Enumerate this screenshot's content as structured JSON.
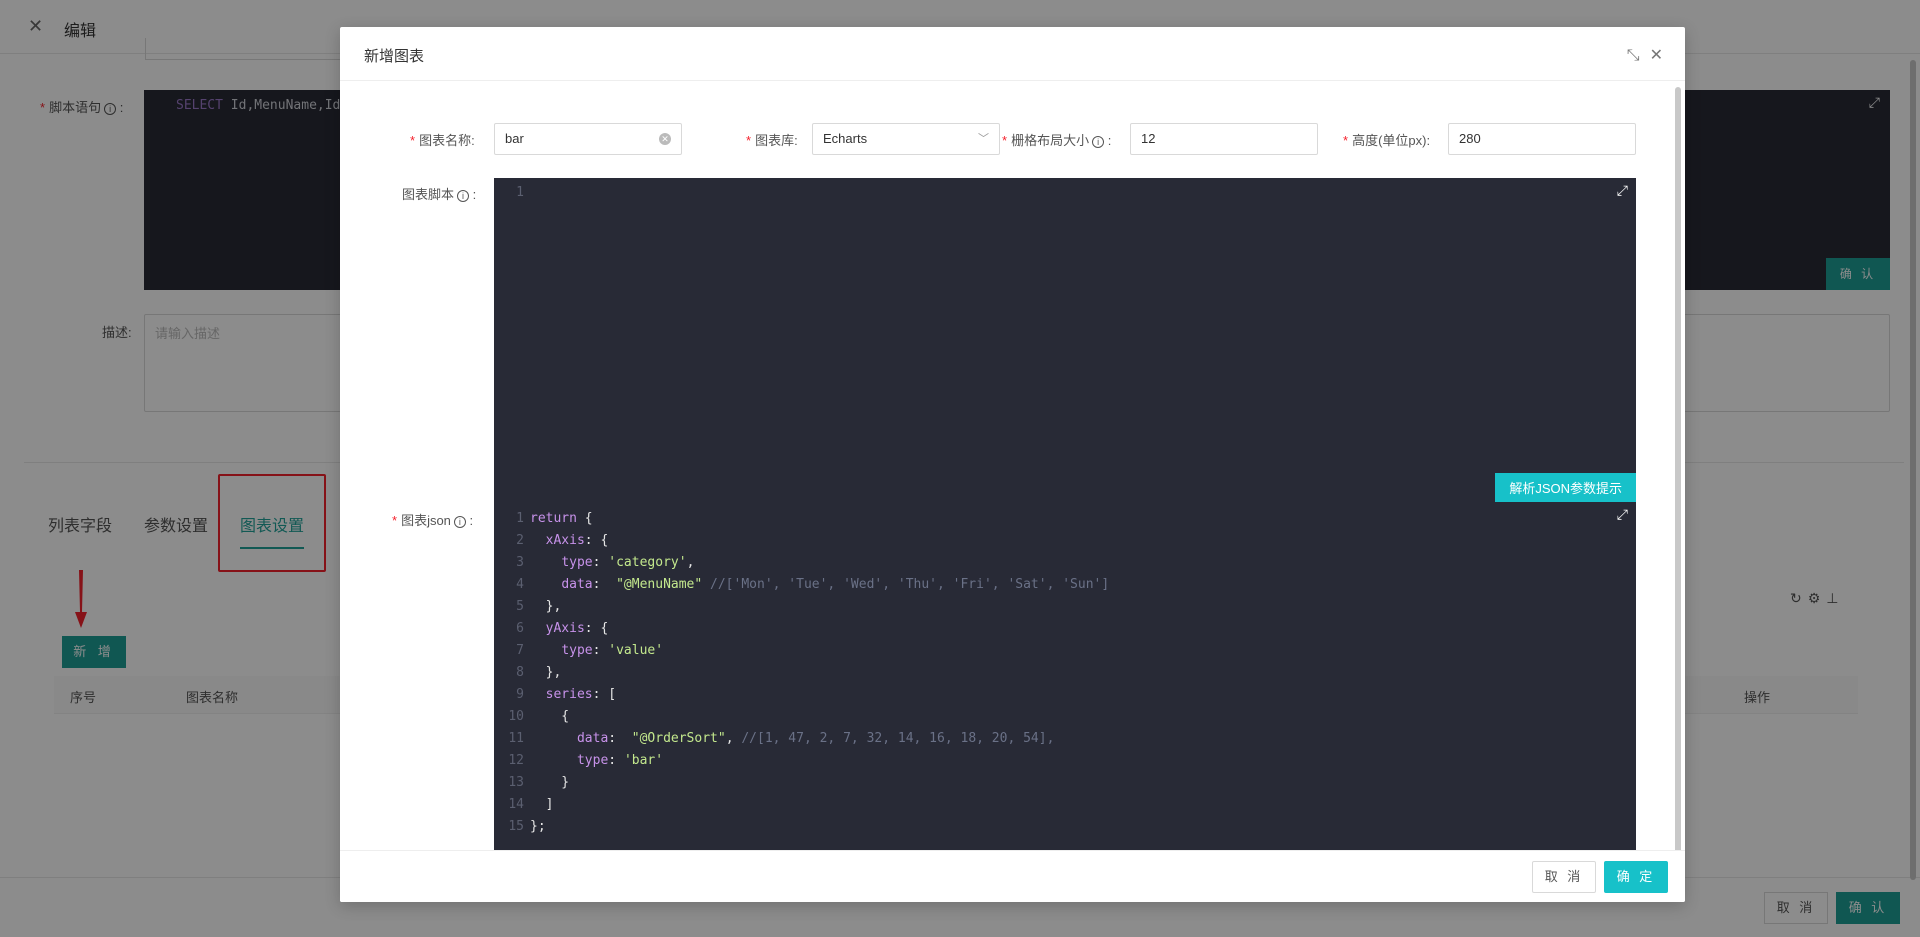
{
  "background": {
    "title": "编辑",
    "script_label": "脚本语句",
    "sql_preview_kw": "SELECT",
    "sql_preview_rest": "Id,MenuName,Id",
    "sql_confirm": "确 认",
    "desc_label": "描述:",
    "desc_placeholder": "请输入描述",
    "tabs": [
      "列表字段",
      "参数设置",
      "图表设置"
    ],
    "active_tab": "图表设置",
    "add_button": "新 增",
    "table_headers": [
      "序号",
      "图表名称",
      "操作"
    ],
    "tool_icons": [
      "refresh-icon",
      "settings-icon",
      "column-height-icon"
    ],
    "footer_cancel": "取 消",
    "footer_confirm": "确 认",
    "highlight_color": "#f5222d"
  },
  "modal": {
    "title": "新增图表",
    "fields": {
      "chart_name_label": "图表名称:",
      "chart_name_value": "bar",
      "chart_lib_label": "图表库:",
      "chart_lib_value": "Echarts",
      "grid_size_label": "栅格布局大小",
      "grid_size_value": "12",
      "height_label": "高度(单位px):",
      "height_value": "280",
      "script_label": "图表脚本",
      "json_label": "图表json"
    },
    "script_lines": [
      "1"
    ],
    "parse_button": "解析JSON参数提示",
    "cancel": "取 消",
    "ok": "确 定"
  },
  "code_lines": [
    {
      "n": "1",
      "parts": [
        [
          "kw",
          "return"
        ],
        [
          "p",
          " {"
        ]
      ]
    },
    {
      "n": "2",
      "parts": [
        [
          "p",
          "  "
        ],
        [
          "kw",
          "xAxis"
        ],
        [
          "p",
          ": {"
        ]
      ]
    },
    {
      "n": "3",
      "parts": [
        [
          "p",
          "    "
        ],
        [
          "kw",
          "type"
        ],
        [
          "p",
          ": "
        ],
        [
          "str",
          "'category'"
        ],
        [
          "p",
          ","
        ]
      ]
    },
    {
      "n": "4",
      "parts": [
        [
          "p",
          "    "
        ],
        [
          "kw",
          "data"
        ],
        [
          "p",
          ":  "
        ],
        [
          "str",
          "\"@MenuName\""
        ],
        [
          "p",
          " "
        ],
        [
          "cm",
          "//['Mon', 'Tue', 'Wed', 'Thu', 'Fri', 'Sat', 'Sun']"
        ]
      ]
    },
    {
      "n": "5",
      "parts": [
        [
          "p",
          "  },"
        ]
      ]
    },
    {
      "n": "6",
      "parts": [
        [
          "p",
          "  "
        ],
        [
          "kw",
          "yAxis"
        ],
        [
          "p",
          ": {"
        ]
      ]
    },
    {
      "n": "7",
      "parts": [
        [
          "p",
          "    "
        ],
        [
          "kw",
          "type"
        ],
        [
          "p",
          ": "
        ],
        [
          "str",
          "'value'"
        ]
      ]
    },
    {
      "n": "8",
      "parts": [
        [
          "p",
          "  },"
        ]
      ]
    },
    {
      "n": "9",
      "parts": [
        [
          "p",
          "  "
        ],
        [
          "kw",
          "series"
        ],
        [
          "p",
          ": ["
        ]
      ]
    },
    {
      "n": "10",
      "parts": [
        [
          "p",
          "    {"
        ]
      ]
    },
    {
      "n": "11",
      "parts": [
        [
          "p",
          "      "
        ],
        [
          "kw",
          "data"
        ],
        [
          "p",
          ":  "
        ],
        [
          "str",
          "\"@OrderSort\""
        ],
        [
          "p",
          ", "
        ],
        [
          "cm",
          "//[1, 47, 2, 7, 32, 14, 16, 18, 20, 54],"
        ]
      ]
    },
    {
      "n": "12",
      "parts": [
        [
          "p",
          "      "
        ],
        [
          "kw",
          "type"
        ],
        [
          "p",
          ": "
        ],
        [
          "str",
          "'bar'"
        ]
      ]
    },
    {
      "n": "13",
      "parts": [
        [
          "p",
          "    }"
        ]
      ]
    },
    {
      "n": "14",
      "parts": [
        [
          "p",
          "  ]"
        ]
      ]
    },
    {
      "n": "15",
      "parts": [
        [
          "p",
          "};"
        ]
      ]
    }
  ]
}
